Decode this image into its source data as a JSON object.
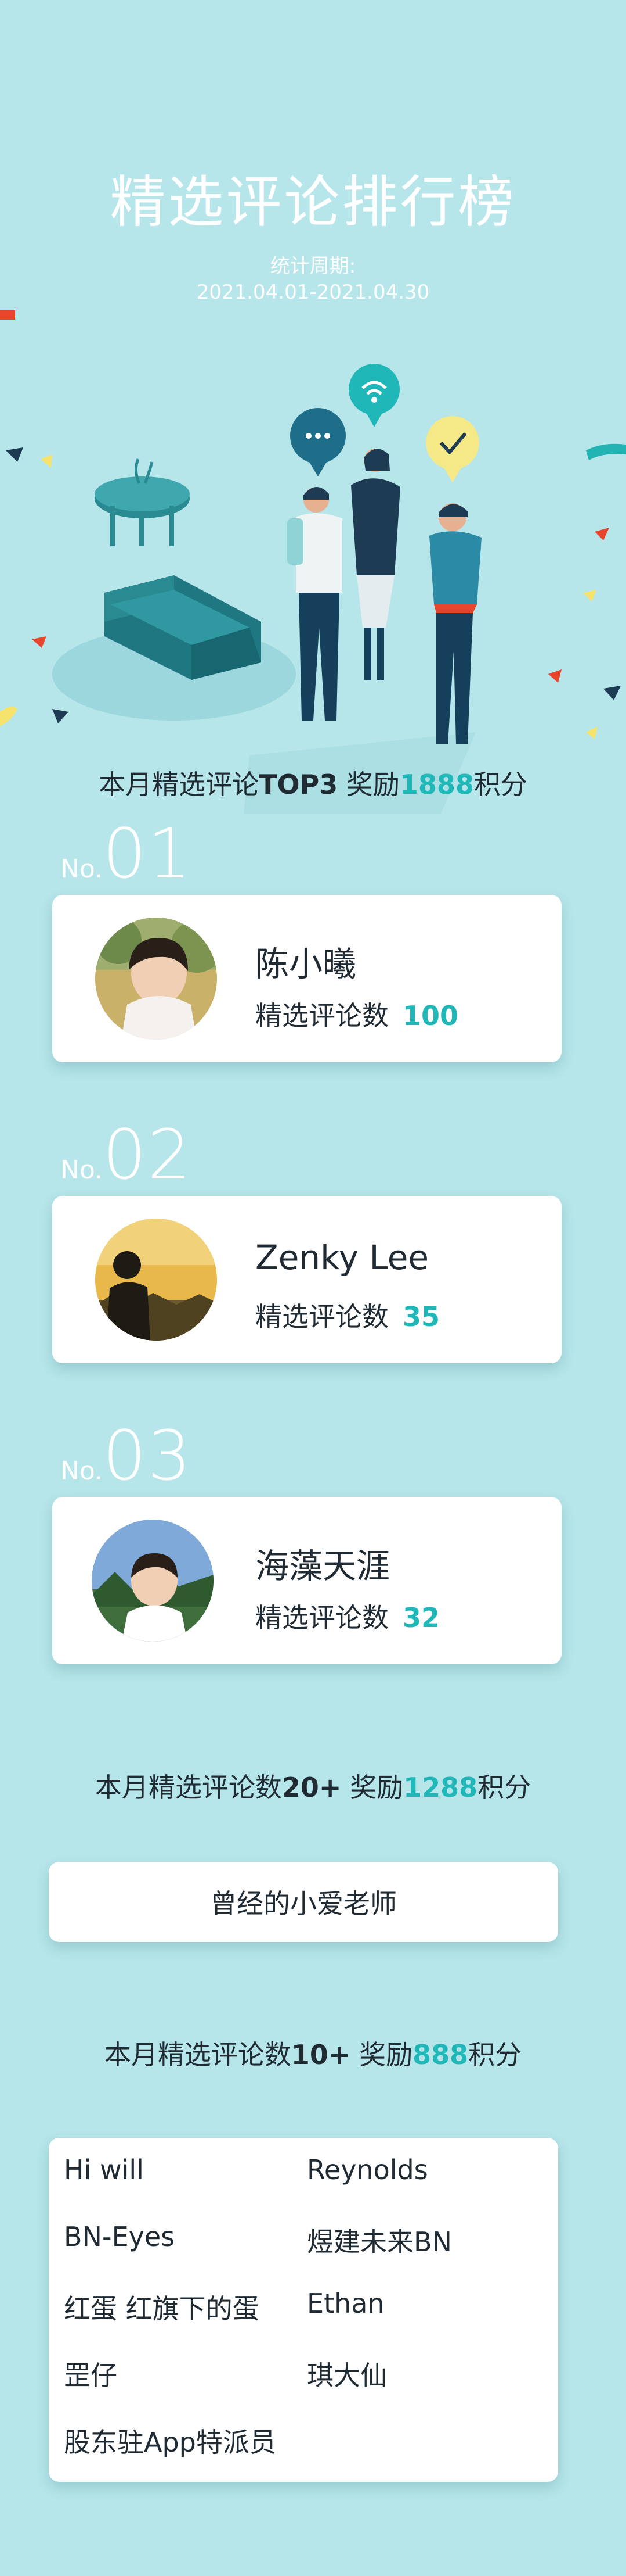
{
  "title": "精选评论排行榜",
  "period": {
    "label": "统计周期:",
    "value": "2021.04.01-2021.04.30"
  },
  "top3_heading": {
    "prefix": "本月精选评论",
    "emph": "TOP3",
    "mid": " 奖励",
    "points": "1888",
    "suffix": "积分"
  },
  "ranks": [
    {
      "no_prefix": "No.",
      "no": "01",
      "name": "陈小曦",
      "count_label": "精选评论数",
      "count": "100"
    },
    {
      "no_prefix": "No.",
      "no": "02",
      "name": "Zenky Lee",
      "count_label": "精选评论数",
      "count": "35"
    },
    {
      "no_prefix": "No.",
      "no": "03",
      "name": "海藻天涯",
      "count_label": "精选评论数",
      "count": "32"
    }
  ],
  "tier20": {
    "prefix": "本月精选评论数",
    "emph": "20+",
    "mid": " 奖励",
    "points": "1288",
    "suffix": "积分",
    "names": [
      "曾经的小爱老师"
    ]
  },
  "tier10": {
    "prefix": "本月精选评论数",
    "emph": "10+",
    "mid": " 奖励",
    "points": "888",
    "suffix": "积分",
    "names": [
      "Hi will",
      "Reynolds",
      "BN-Eyes",
      "煜建未来BN",
      "红蛋 红旗下的蛋",
      "Ethan",
      "罡仔",
      "琪大仙",
      "股东驻App特派员"
    ]
  },
  "colors": {
    "background": "#b6e6ea",
    "accent": "#1fb7b7",
    "text": "#1f2a33"
  }
}
